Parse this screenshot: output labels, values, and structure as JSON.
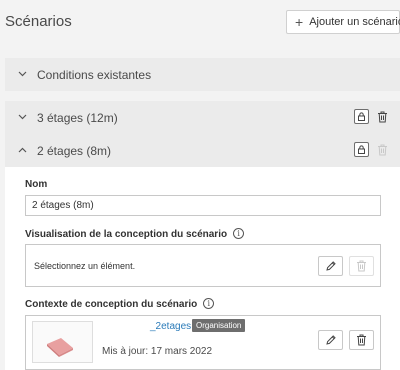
{
  "header": {
    "title": "Scénarios",
    "add_button_label": "Ajouter un scénario"
  },
  "scenarios": [
    {
      "label": "Conditions existantes",
      "expanded": false
    },
    {
      "label": "3 étages (12m)",
      "expanded": false
    },
    {
      "label": "2 étages (8m)",
      "expanded": true
    }
  ],
  "details": {
    "name_label": "Nom",
    "name_value": "2 étages (8m)",
    "visualisation_label": "Visualisation de la conception du scénario",
    "visualisation_placeholder": "Sélectionnez un élément.",
    "context_label": "Contexte de conception du scénario",
    "context_item": {
      "name": "_2etages",
      "badge": "Organisation",
      "updated": "Mis à jour: 17 mars 2022"
    }
  },
  "icons": {
    "chevron_collapsed": "chevron-down-icon",
    "chevron_expanded": "chevron-up-icon",
    "lock": "lock-icon",
    "trash": "trash-icon",
    "edit": "pencil-icon",
    "info": "info-icon",
    "plus": "plus-icon"
  }
}
